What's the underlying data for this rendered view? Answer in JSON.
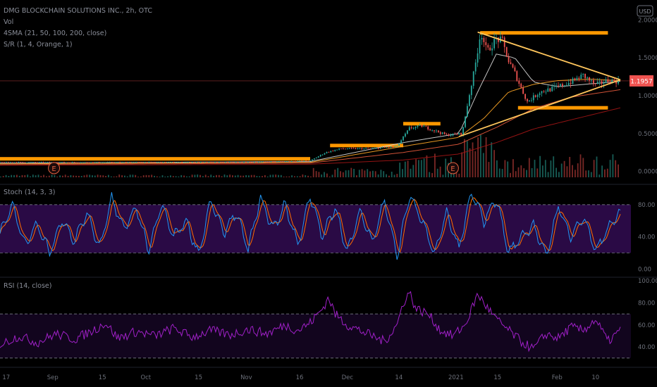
{
  "header": {
    "title": "DMG BLOCKCHAIN SOLUTIONS INC., 2h, OTC",
    "lines": [
      "Vol",
      "4SMA (21, 50, 100, 200, close)",
      "S/R (1, 4, Orange, 1)"
    ],
    "currency_badge": "USD"
  },
  "colors": {
    "background": "#000000",
    "candle_up": "#26a69a",
    "candle_down": "#ef5350",
    "sma21": "#d9d9d9",
    "sma50": "#ffa726",
    "sma100": "#e55a3c",
    "sma200": "#a31515",
    "sr_zone": "#ff9800",
    "triangle": "#ffc65c",
    "stoch_k": "#2196f3",
    "stoch_d": "#ff6d00",
    "stoch_band": "#2a0a45",
    "rsi_line": "#a020c8",
    "price_badge": "#ef5350"
  },
  "chart_data": [
    {
      "type": "candlestick",
      "pane": "price",
      "y_ticks": [
        "2.0000",
        "1.5000",
        "1.0000",
        "0.5000",
        "0.0000"
      ],
      "ylim": [
        -0.06,
        2.06
      ],
      "last_price": 1.1957,
      "last_price_label": "1.1957",
      "earnings_markers": [
        {
          "x": 0.087,
          "label": "E"
        },
        {
          "x": 0.73,
          "label": "E"
        }
      ],
      "sr_zones": [
        {
          "x0": 0.0,
          "x1": 0.5,
          "price": 0.166
        },
        {
          "x0": 0.532,
          "x1": 0.65,
          "price": 0.342
        },
        {
          "x0": 0.65,
          "x1": 0.71,
          "price": 0.63
        },
        {
          "x0": 0.774,
          "x1": 0.98,
          "price": 1.83
        },
        {
          "x0": 0.835,
          "x1": 0.98,
          "price": 0.84
        }
      ],
      "trendlines": [
        {
          "from": [
            0.77,
            1.84
          ],
          "to": [
            1.0,
            1.21
          ]
        },
        {
          "from": [
            0.74,
            0.46
          ],
          "to": [
            1.0,
            1.21
          ]
        }
      ],
      "price_series": [
        [
          0.0,
          0.12
        ],
        [
          0.1,
          0.12
        ],
        [
          0.2,
          0.12
        ],
        [
          0.3,
          0.12
        ],
        [
          0.4,
          0.12
        ],
        [
          0.5,
          0.14
        ],
        [
          0.525,
          0.25
        ],
        [
          0.55,
          0.3
        ],
        [
          0.6,
          0.3
        ],
        [
          0.64,
          0.33
        ],
        [
          0.66,
          0.57
        ],
        [
          0.68,
          0.6
        ],
        [
          0.72,
          0.48
        ],
        [
          0.745,
          0.5
        ],
        [
          0.755,
          0.95
        ],
        [
          0.765,
          1.35
        ],
        [
          0.775,
          1.85
        ],
        [
          0.785,
          1.58
        ],
        [
          0.8,
          1.75
        ],
        [
          0.81,
          1.72
        ],
        [
          0.82,
          1.45
        ],
        [
          0.83,
          1.3
        ],
        [
          0.84,
          1.1
        ],
        [
          0.85,
          0.92
        ],
        [
          0.86,
          0.98
        ],
        [
          0.87,
          1.05
        ],
        [
          0.885,
          1.08
        ],
        [
          0.9,
          1.12
        ],
        [
          0.92,
          1.18
        ],
        [
          0.94,
          1.27
        ],
        [
          0.96,
          1.14
        ],
        [
          0.98,
          1.2
        ],
        [
          1.0,
          1.19
        ]
      ],
      "sma_series": [
        {
          "key": "sma21",
          "points": [
            [
              0.0,
              0.11
            ],
            [
              0.5,
              0.13
            ],
            [
              0.65,
              0.38
            ],
            [
              0.74,
              0.5
            ],
            [
              0.77,
              1.05
            ],
            [
              0.8,
              1.55
            ],
            [
              0.83,
              1.5
            ],
            [
              0.86,
              1.18
            ],
            [
              0.9,
              1.12
            ],
            [
              1.0,
              1.19
            ]
          ]
        },
        {
          "key": "sma50",
          "points": [
            [
              0.0,
              0.1
            ],
            [
              0.5,
              0.12
            ],
            [
              0.65,
              0.33
            ],
            [
              0.74,
              0.45
            ],
            [
              0.78,
              0.7
            ],
            [
              0.82,
              1.05
            ],
            [
              0.86,
              1.15
            ],
            [
              0.9,
              1.2
            ],
            [
              0.95,
              1.22
            ],
            [
              1.0,
              1.2
            ]
          ]
        },
        {
          "key": "sma100",
          "points": [
            [
              0.0,
              0.09
            ],
            [
              0.5,
              0.11
            ],
            [
              0.65,
              0.25
            ],
            [
              0.74,
              0.36
            ],
            [
              0.8,
              0.58
            ],
            [
              0.86,
              0.83
            ],
            [
              0.92,
              0.98
            ],
            [
              1.0,
              1.08
            ]
          ]
        },
        {
          "key": "sma200",
          "points": [
            [
              0.0,
              0.08
            ],
            [
              0.5,
              0.095
            ],
            [
              0.65,
              0.15
            ],
            [
              0.74,
              0.23
            ],
            [
              0.8,
              0.38
            ],
            [
              0.86,
              0.56
            ],
            [
              0.92,
              0.68
            ],
            [
              1.0,
              0.84
            ]
          ]
        }
      ]
    },
    {
      "type": "line",
      "pane": "stoch",
      "label": "Stoch (14, 3, 3)",
      "y_ticks": [
        "80.00",
        "40.00",
        "0.00"
      ],
      "ylim": [
        -5,
        100
      ],
      "band": [
        20,
        80
      ],
      "k_series": [
        [
          0.0,
          45
        ],
        [
          0.02,
          80
        ],
        [
          0.04,
          30
        ],
        [
          0.06,
          55
        ],
        [
          0.08,
          20
        ],
        [
          0.1,
          60
        ],
        [
          0.12,
          35
        ],
        [
          0.14,
          70
        ],
        [
          0.16,
          25
        ],
        [
          0.18,
          88
        ],
        [
          0.2,
          50
        ],
        [
          0.22,
          75
        ],
        [
          0.24,
          22
        ],
        [
          0.26,
          80
        ],
        [
          0.28,
          40
        ],
        [
          0.3,
          60
        ],
        [
          0.32,
          18
        ],
        [
          0.34,
          85
        ],
        [
          0.36,
          45
        ],
        [
          0.38,
          70
        ],
        [
          0.4,
          25
        ],
        [
          0.42,
          88
        ],
        [
          0.44,
          50
        ],
        [
          0.46,
          80
        ],
        [
          0.48,
          30
        ],
        [
          0.5,
          90
        ],
        [
          0.52,
          40
        ],
        [
          0.54,
          78
        ],
        [
          0.56,
          20
        ],
        [
          0.58,
          72
        ],
        [
          0.6,
          35
        ],
        [
          0.62,
          85
        ],
        [
          0.64,
          15
        ],
        [
          0.66,
          92
        ],
        [
          0.68,
          60
        ],
        [
          0.7,
          18
        ],
        [
          0.72,
          70
        ],
        [
          0.74,
          25
        ],
        [
          0.76,
          95
        ],
        [
          0.78,
          60
        ],
        [
          0.8,
          88
        ],
        [
          0.82,
          20
        ],
        [
          0.84,
          40
        ],
        [
          0.86,
          55
        ],
        [
          0.88,
          15
        ],
        [
          0.9,
          78
        ],
        [
          0.92,
          40
        ],
        [
          0.94,
          65
        ],
        [
          0.96,
          22
        ],
        [
          0.98,
          50
        ],
        [
          1.0,
          70
        ]
      ]
    },
    {
      "type": "line",
      "pane": "rsi",
      "label": "RSI (14, close)",
      "y_ticks": [
        "100.00",
        "80.00",
        "60.00",
        "40.00"
      ],
      "ylim": [
        28,
        102
      ],
      "band": [
        30,
        70
      ],
      "series": [
        [
          0.0,
          42
        ],
        [
          0.03,
          50
        ],
        [
          0.06,
          44
        ],
        [
          0.09,
          52
        ],
        [
          0.12,
          47
        ],
        [
          0.15,
          55
        ],
        [
          0.17,
          62
        ],
        [
          0.19,
          48
        ],
        [
          0.22,
          54
        ],
        [
          0.25,
          50
        ],
        [
          0.28,
          57
        ],
        [
          0.31,
          49
        ],
        [
          0.34,
          55
        ],
        [
          0.37,
          51
        ],
        [
          0.4,
          56
        ],
        [
          0.43,
          52
        ],
        [
          0.46,
          60
        ],
        [
          0.48,
          55
        ],
        [
          0.5,
          62
        ],
        [
          0.52,
          75
        ],
        [
          0.53,
          85
        ],
        [
          0.54,
          70
        ],
        [
          0.56,
          60
        ],
        [
          0.58,
          55
        ],
        [
          0.6,
          50
        ],
        [
          0.62,
          45
        ],
        [
          0.64,
          60
        ],
        [
          0.65,
          80
        ],
        [
          0.66,
          90
        ],
        [
          0.67,
          75
        ],
        [
          0.69,
          70
        ],
        [
          0.71,
          55
        ],
        [
          0.73,
          50
        ],
        [
          0.75,
          60
        ],
        [
          0.77,
          88
        ],
        [
          0.78,
          80
        ],
        [
          0.8,
          65
        ],
        [
          0.82,
          55
        ],
        [
          0.84,
          45
        ],
        [
          0.86,
          38
        ],
        [
          0.88,
          52
        ],
        [
          0.9,
          48
        ],
        [
          0.92,
          58
        ],
        [
          0.94,
          55
        ],
        [
          0.96,
          65
        ],
        [
          0.98,
          45
        ],
        [
          1.0,
          55
        ]
      ]
    }
  ],
  "x_axis": {
    "labels": [
      {
        "text": "17",
        "x": 0.01
      },
      {
        "text": "Sep",
        "x": 0.085
      },
      {
        "text": "15",
        "x": 0.165
      },
      {
        "text": "Oct",
        "x": 0.235
      },
      {
        "text": "15",
        "x": 0.32
      },
      {
        "text": "Nov",
        "x": 0.397
      },
      {
        "text": "16",
        "x": 0.483
      },
      {
        "text": "Dec",
        "x": 0.56
      },
      {
        "text": "14",
        "x": 0.643
      },
      {
        "text": "2021",
        "x": 0.735
      },
      {
        "text": "15",
        "x": 0.802
      },
      {
        "text": "Feb",
        "x": 0.898
      },
      {
        "text": "10",
        "x": 0.96
      }
    ]
  }
}
